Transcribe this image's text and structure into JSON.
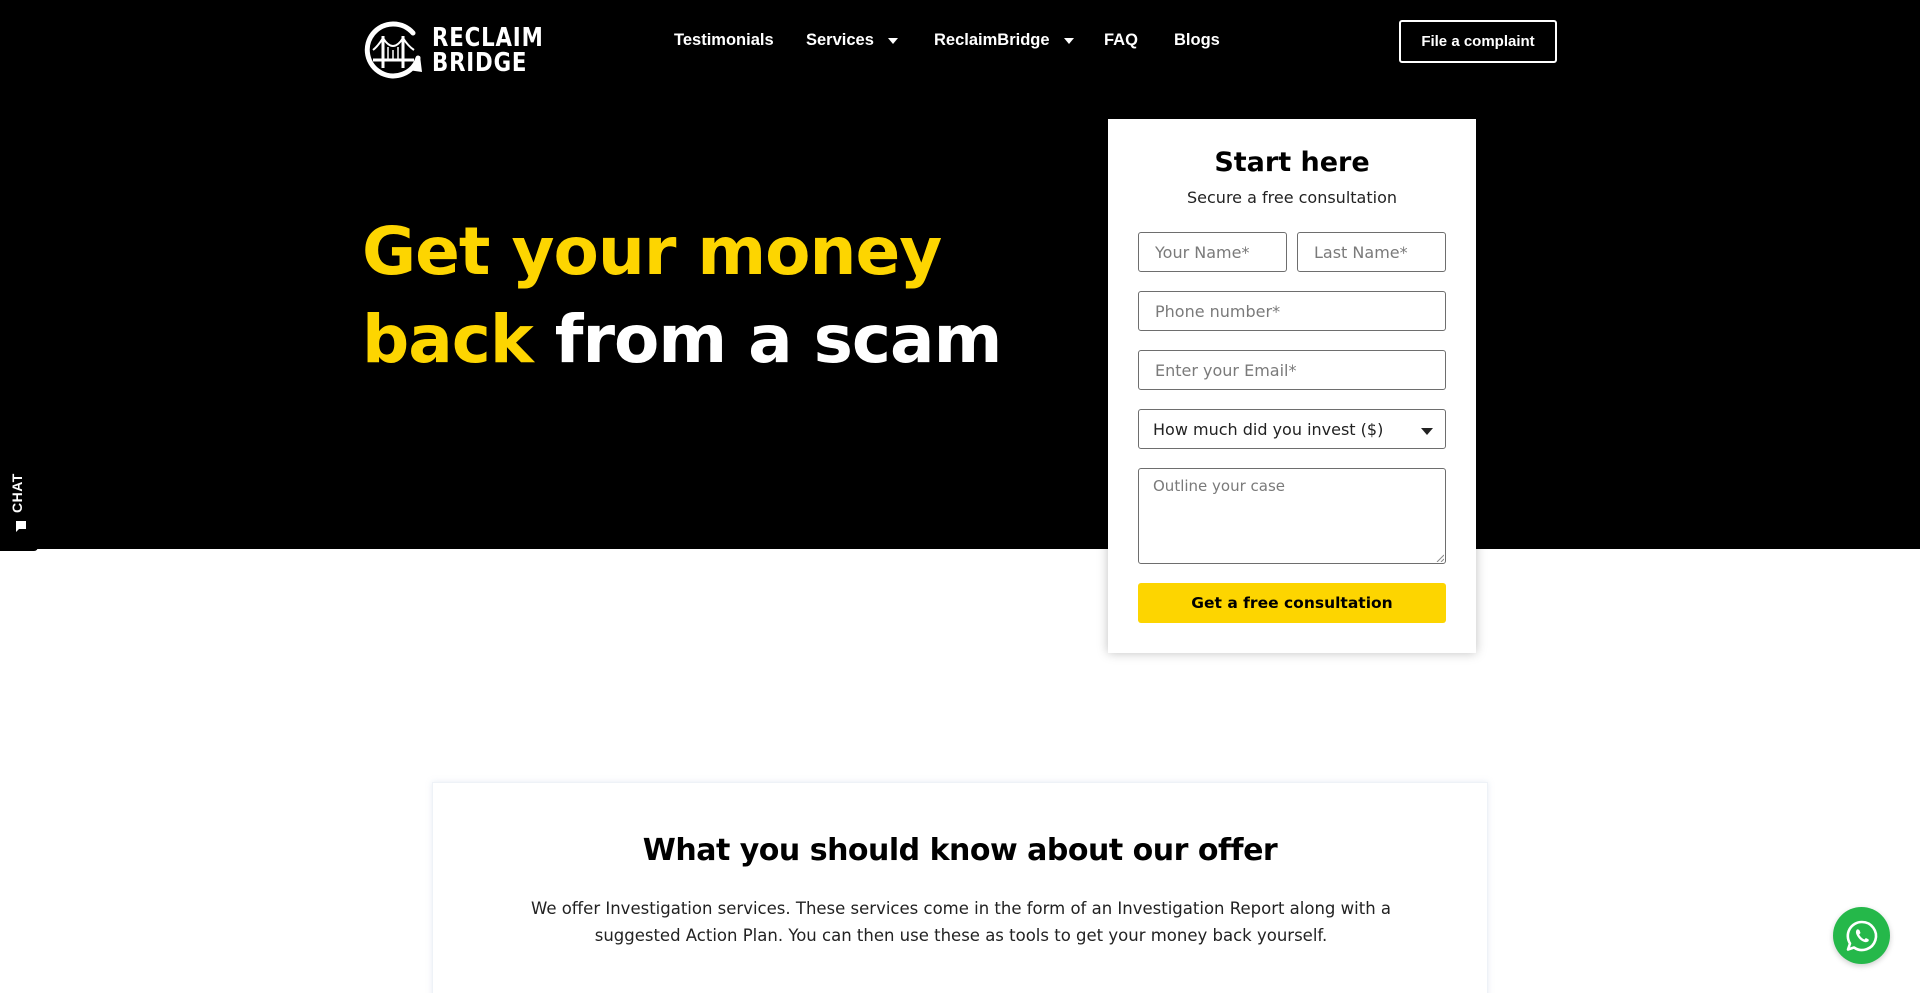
{
  "brand": {
    "name_line1": "RECLAIM",
    "name_line2": "BRIDGE",
    "logo_icon": "bridge-circle-arrow-icon"
  },
  "nav": {
    "items": [
      {
        "label": "Testimonials",
        "has_dropdown": false
      },
      {
        "label": "Services",
        "has_dropdown": true
      },
      {
        "label": "ReclaimBridge",
        "has_dropdown": true
      },
      {
        "label": "FAQ",
        "has_dropdown": false
      },
      {
        "label": "Blogs",
        "has_dropdown": false
      }
    ],
    "cta_label": "File a complaint"
  },
  "hero": {
    "line1": "Get your money",
    "line2_highlight": "back",
    "line2_rest": "from a scam",
    "highlight_color": "#fdd500"
  },
  "chat": {
    "label": "CHAT",
    "icon": "chat-bubble-icon"
  },
  "form": {
    "title": "Start here",
    "subtitle": "Secure a free consultation",
    "first_name_placeholder": "Your Name*",
    "last_name_placeholder": "Last Name*",
    "phone_placeholder": "Phone number*",
    "email_placeholder": "Enter your Email*",
    "invest_select_value": "How much did you invest ($)",
    "case_placeholder": "Outline your case",
    "submit_label": "Get a free consultation",
    "button_color": "#fdd500"
  },
  "offer": {
    "title": "What you should know about our offer",
    "text": "We offer Investigation services. These services come in the form of an Investigation Report along with a suggested Action Plan. You can then use these as tools to get your money back yourself."
  },
  "whatsapp": {
    "icon": "whatsapp-icon",
    "color": "#25b84a"
  }
}
